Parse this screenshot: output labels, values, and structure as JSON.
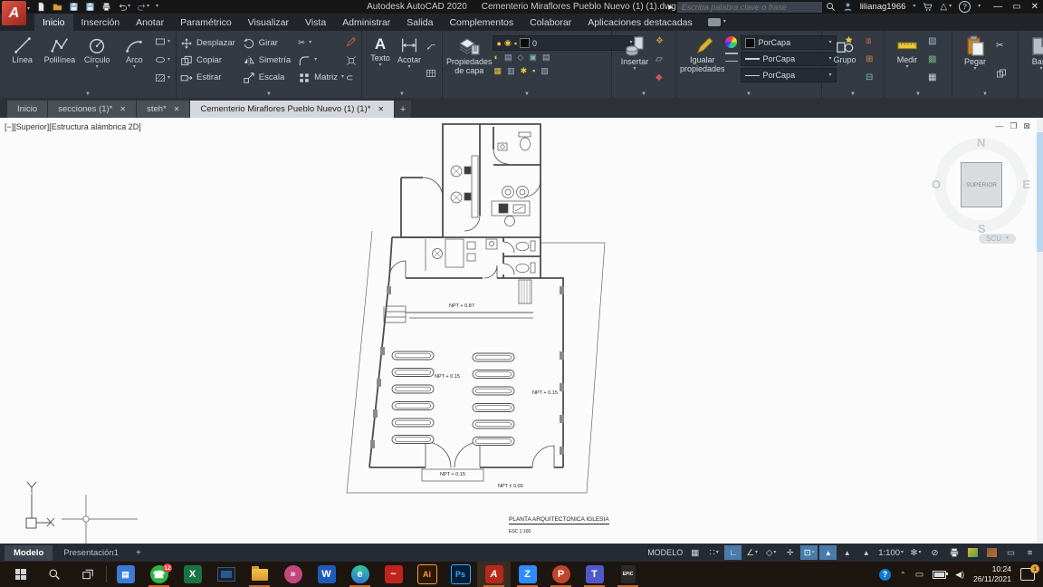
{
  "window": {
    "app_title": "Autodesk AutoCAD 2020",
    "doc_title": "Cementerio Miraflores Pueblo Nuevo  (1) (1).dwg",
    "search_placeholder": "Escriba palabra clave o frase",
    "username": "lilianag1966"
  },
  "menu": {
    "tabs": [
      "Inicio",
      "Inserción",
      "Anotar",
      "Paramétrico",
      "Visualizar",
      "Vista",
      "Administrar",
      "Salida",
      "Complementos",
      "Colaborar",
      "Aplicaciones destacadas"
    ],
    "active_tab": "Inicio"
  },
  "ribbon": {
    "draw": {
      "line": "Línea",
      "polyline": "Polilínea",
      "circle": "Círculo",
      "arc": "Arco"
    },
    "modify": {
      "move": "Desplazar",
      "rotate": "Girar",
      "copy": "Copiar",
      "mirror": "Simetría",
      "stretch": "Estirar",
      "scale": "Escala",
      "array": "Matriz"
    },
    "annotate": {
      "text": "Texto",
      "dim": "Acotar"
    },
    "layers": {
      "properties_line1": "Propiedades",
      "properties_line2": "de capa",
      "current_layer": "0"
    },
    "block": {
      "insert": "Insertar"
    },
    "properties": {
      "match_line1": "Igualar",
      "match_line2": "propiedades",
      "color": "PorCapa",
      "lineweight": "PorCapa",
      "linetype": "PorCapa"
    },
    "group": {
      "label": "Grupo"
    },
    "measure": {
      "label": "Medir"
    },
    "clipboard": {
      "label": "Pegar"
    },
    "base": {
      "label": "Base"
    }
  },
  "file_tabs": {
    "items": [
      "Inicio",
      "secciones (1)*",
      "steh*",
      "Cementerio Miraflores Pueblo Nuevo  (1) (1)*"
    ],
    "active": "Cementerio Miraflores Pueblo Nuevo  (1) (1)*",
    "new_tab": "+"
  },
  "viewport": {
    "label": "[−][Superior][Estructura alámbrica 2D]",
    "viewcube": {
      "north": "N",
      "south": "S",
      "east": "E",
      "west": "O",
      "face": "SUPERIOR",
      "ucs_label": "SCU"
    }
  },
  "plan": {
    "labels": [
      {
        "text": "NPT + 0.87"
      },
      {
        "text": "NPT + 0.15"
      },
      {
        "text": "NPT + 0.15"
      },
      {
        "text": "NPT + 0.15"
      },
      {
        "text": "NPT ± 0.00"
      }
    ],
    "title": "PLANTA ARQUITECTONICA IGLESIA",
    "scale": "ESC 1:100"
  },
  "status_bar": {
    "model_tab": "Modelo",
    "layout_tab": "Presentación1",
    "new_layout": "+",
    "space_label": "MODELO",
    "annotation_scale": "1:100"
  },
  "taskbar": {
    "whatsapp_badge": "12",
    "clock_time": "10:24",
    "clock_date": "26/11/2021",
    "notification_badge": "1",
    "epic_label": "EPIC"
  },
  "theme": {
    "accent_red": "#c0392b",
    "ribbon_bg": "#343a43",
    "highlight_blue": "#4a7bab",
    "canvas_bg": "#fbfbfb",
    "taskbar_underline": "#c06a3a"
  }
}
